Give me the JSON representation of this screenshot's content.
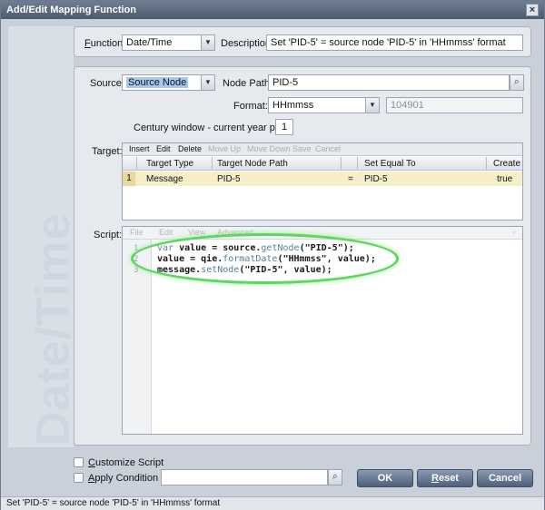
{
  "window": {
    "title": "Add/Edit Mapping Function",
    "close_glyph": "×"
  },
  "watermark": "Date/Time",
  "function": {
    "label_prefix": "F",
    "label_rest": "unction:",
    "value": "Date/Time",
    "description_label": "Description:",
    "description_value": "Set 'PID-5' = source node 'PID-5' in 'HHmmss' format"
  },
  "source": {
    "label": "Source:",
    "value": "Source Node",
    "node_path_label": "Node Path:",
    "node_path_value": "PID-5",
    "format_label": "Format:",
    "format_value": "HHmmss",
    "format_preview": "104901",
    "century_label": "Century window - current year plus:",
    "century_value": "1"
  },
  "target": {
    "label": "Target:",
    "toolbar": {
      "insert": "Insert",
      "edit": "Edit",
      "delete": "Delete",
      "move_up": "Move Up",
      "move_down": "Move Down",
      "save": "Save",
      "cancel": "Cancel"
    },
    "columns": {
      "type": "Target Type",
      "path": "Target Node Path",
      "set_equal": "Set Equal To",
      "create": "Create"
    },
    "rows": [
      {
        "num": "1",
        "type": "Message",
        "path": "PID-5",
        "op": "=",
        "set_equal": "PID-5",
        "create": "true"
      }
    ]
  },
  "script": {
    "label": "Script:",
    "toolbar": {
      "file": "File",
      "edit": "Edit",
      "view": "View",
      "advanced": "Advanced"
    },
    "lines": [
      {
        "num": "1",
        "kw": "var ",
        "a": "value = source.",
        "fn": "getNode",
        "b": "(\"PID-5\");"
      },
      {
        "num": "2",
        "kw": "",
        "a": "value = qie.",
        "fn": "formatDate",
        "b": "(\"HHmmss\", value);"
      },
      {
        "num": "3",
        "kw": "",
        "a": "message.",
        "fn": "setNode",
        "b": "(\"PID-5\", value);"
      }
    ]
  },
  "options": {
    "customize_prefix": "C",
    "customize_rest": "ustomize Script",
    "apply_prefix": "A",
    "apply_rest": "pply Condition",
    "condition_value": ""
  },
  "buttons": {
    "ok": "OK",
    "reset_prefix": "R",
    "reset_rest": "eset",
    "cancel": "Cancel"
  },
  "status": "Set 'PID-5' = source node 'PID-5' in 'HHmmss' format"
}
